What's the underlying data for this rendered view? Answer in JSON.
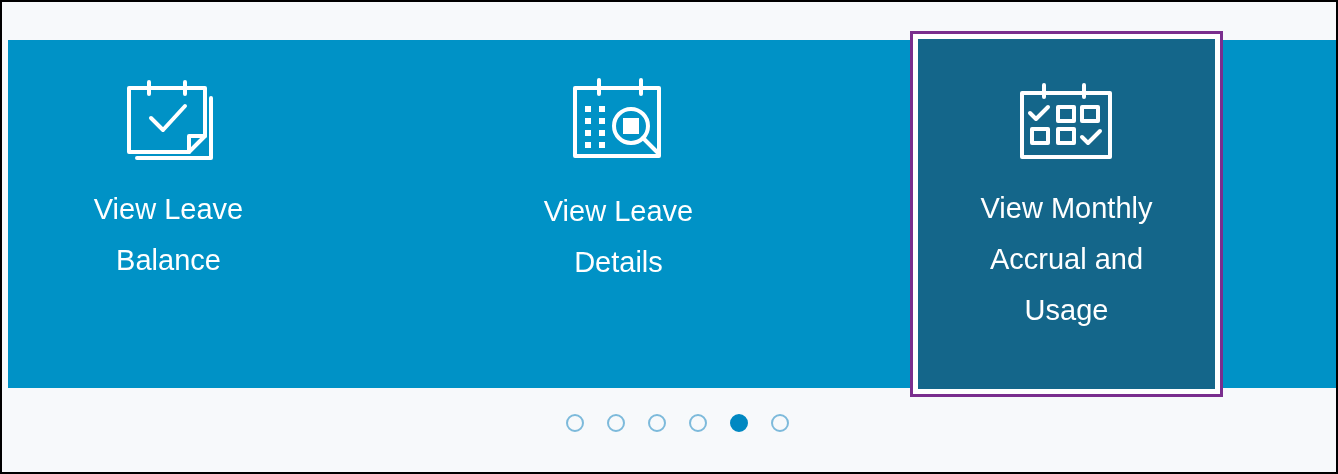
{
  "tiles": [
    {
      "label": "View Leave Balance",
      "selected": false
    },
    {
      "label": "View Leave Details",
      "selected": false
    },
    {
      "label": "View Monthly Accrual and Usage",
      "selected": true
    }
  ],
  "pager": [
    {
      "selected": false
    },
    {
      "selected": false
    },
    {
      "selected": false
    },
    {
      "selected": false
    },
    {
      "selected": true
    },
    {
      "selected": false
    }
  ]
}
